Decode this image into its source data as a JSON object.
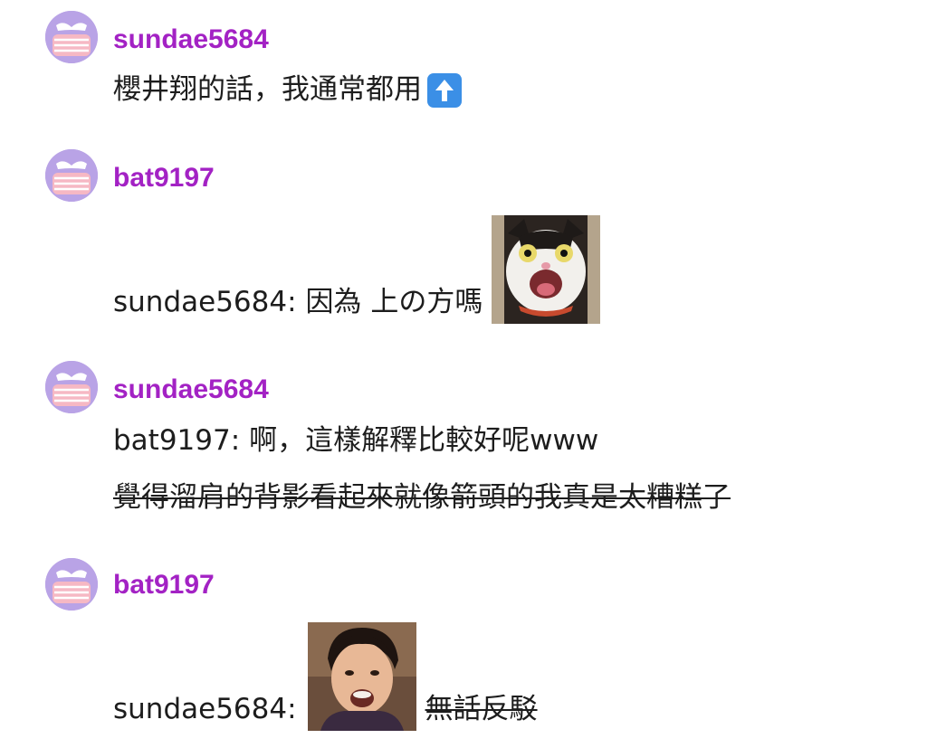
{
  "messages": [
    {
      "username": "sundae5684",
      "lines": [
        {
          "text": "櫻井翔的話，我通常都用",
          "emoji": "up-arrow-emoji"
        }
      ]
    },
    {
      "username": "bat9197",
      "lines": [
        {
          "prefix": "sundae5684:",
          "text": "因為 上の方嗎",
          "sticker": "screaming-cat-sticker"
        }
      ]
    },
    {
      "username": "sundae5684",
      "lines": [
        {
          "prefix": "bat9197:",
          "text": "啊，這樣解釋比較好呢www"
        },
        {
          "text": "覺得溜肩的背影看起來就像箭頭的我真是太糟糕了",
          "strikethrough": true
        }
      ]
    },
    {
      "username": "bat9197",
      "lines": [
        {
          "prefix": "sundae5684:",
          "sticker": "smiling-man-photo-sticker",
          "text": "無話反駁",
          "strikethrough": true
        }
      ]
    }
  ],
  "colors": {
    "username": "#a322c4",
    "avatar_bg": "#b9a3e6",
    "mask": "#f6b8c4",
    "emoji_bg": "#3b8fe6",
    "text": "#1d1d1d"
  }
}
